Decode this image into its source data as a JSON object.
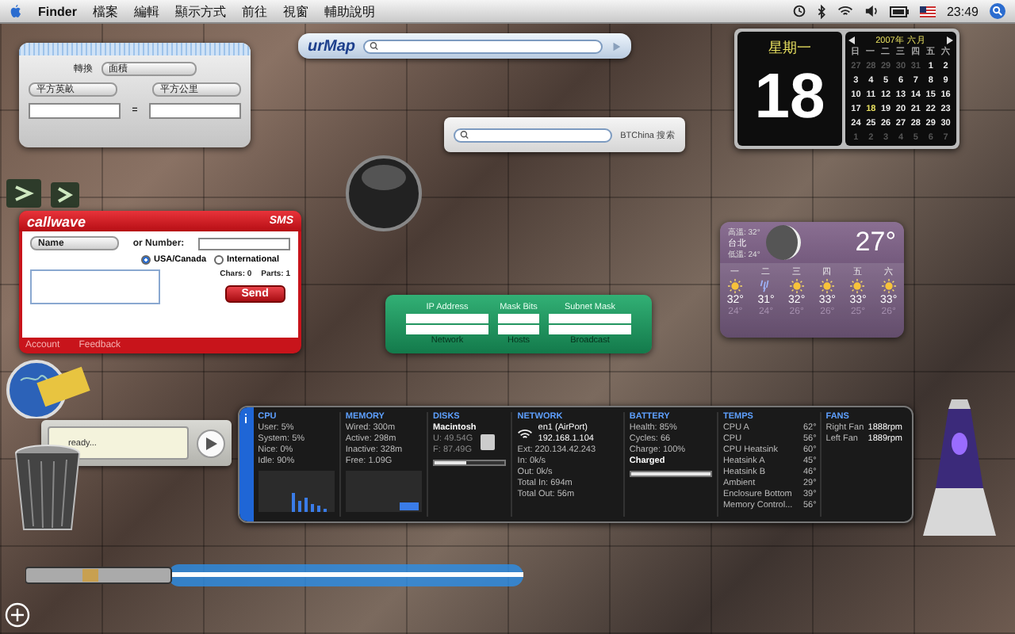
{
  "menu_bar": {
    "app": "Finder",
    "menus": [
      "檔案",
      "編輯",
      "顯示方式",
      "前往",
      "視窗",
      "輔助說明"
    ],
    "clock": "23:49"
  },
  "converter": {
    "type_label": "轉換",
    "type_value": "面積",
    "from_unit": "平方英畝",
    "to_unit": "平方公里",
    "equals": "="
  },
  "urmap": {
    "logo": "urMap"
  },
  "btchina": {
    "label": "BTChina 搜索"
  },
  "calendar": {
    "weekday": "星期一",
    "day": "18",
    "month_title": "2007年 六月",
    "headers": [
      "日",
      "一",
      "二",
      "三",
      "四",
      "五",
      "六"
    ],
    "weeks": [
      [
        {
          "d": "27",
          "muted": true,
          "selected": false
        },
        {
          "d": "28",
          "muted": true,
          "selected": false
        },
        {
          "d": "29",
          "muted": true,
          "selected": false
        },
        {
          "d": "30",
          "muted": true,
          "selected": false
        },
        {
          "d": "31",
          "muted": true,
          "selected": false
        },
        {
          "d": "1",
          "muted": false,
          "selected": false
        },
        {
          "d": "2",
          "muted": false,
          "selected": false
        }
      ],
      [
        {
          "d": "3",
          "muted": false,
          "selected": false
        },
        {
          "d": "4",
          "muted": false,
          "selected": false
        },
        {
          "d": "5",
          "muted": false,
          "selected": false
        },
        {
          "d": "6",
          "muted": false,
          "selected": false
        },
        {
          "d": "7",
          "muted": false,
          "selected": false
        },
        {
          "d": "8",
          "muted": false,
          "selected": false
        },
        {
          "d": "9",
          "muted": false,
          "selected": false
        }
      ],
      [
        {
          "d": "10",
          "muted": false,
          "selected": false
        },
        {
          "d": "11",
          "muted": false,
          "selected": false
        },
        {
          "d": "12",
          "muted": false,
          "selected": false
        },
        {
          "d": "13",
          "muted": false,
          "selected": false
        },
        {
          "d": "14",
          "muted": false,
          "selected": false
        },
        {
          "d": "15",
          "muted": false,
          "selected": false
        },
        {
          "d": "16",
          "muted": false,
          "selected": false
        }
      ],
      [
        {
          "d": "17",
          "muted": false,
          "selected": false
        },
        {
          "d": "18",
          "muted": false,
          "selected": true
        },
        {
          "d": "19",
          "muted": false,
          "selected": false
        },
        {
          "d": "20",
          "muted": false,
          "selected": false
        },
        {
          "d": "21",
          "muted": false,
          "selected": false
        },
        {
          "d": "22",
          "muted": false,
          "selected": false
        },
        {
          "d": "23",
          "muted": false,
          "selected": false
        }
      ],
      [
        {
          "d": "24",
          "muted": false,
          "selected": false
        },
        {
          "d": "25",
          "muted": false,
          "selected": false
        },
        {
          "d": "26",
          "muted": false,
          "selected": false
        },
        {
          "d": "27",
          "muted": false,
          "selected": false
        },
        {
          "d": "28",
          "muted": false,
          "selected": false
        },
        {
          "d": "29",
          "muted": false,
          "selected": false
        },
        {
          "d": "30",
          "muted": false,
          "selected": false
        }
      ],
      [
        {
          "d": "1",
          "muted": true,
          "selected": false
        },
        {
          "d": "2",
          "muted": true,
          "selected": false
        },
        {
          "d": "3",
          "muted": true,
          "selected": false
        },
        {
          "d": "4",
          "muted": true,
          "selected": false
        },
        {
          "d": "5",
          "muted": true,
          "selected": false
        },
        {
          "d": "6",
          "muted": true,
          "selected": false
        },
        {
          "d": "7",
          "muted": true,
          "selected": false
        }
      ]
    ]
  },
  "sms": {
    "brand": "callwave",
    "title": "SMS",
    "name_select": "Name",
    "number_label": "or Number:",
    "regions": [
      {
        "label": "USA/Canada",
        "selected": true
      },
      {
        "label": "International",
        "selected": false
      }
    ],
    "chars": "Chars: 0",
    "parts": "Parts: 1",
    "send": "Send",
    "links": [
      "Account",
      "Feedback"
    ]
  },
  "weather": {
    "high": "高溫: 32°",
    "city": "台北",
    "low": "低溫: 24°",
    "temp": "27°",
    "forecast": [
      {
        "day": "一",
        "kind": "sunny",
        "high": "32°",
        "low": "24°"
      },
      {
        "day": "二",
        "kind": "rain",
        "high": "31°",
        "low": "24°"
      },
      {
        "day": "三",
        "kind": "sunny",
        "high": "32°",
        "low": "26°"
      },
      {
        "day": "四",
        "kind": "sunny",
        "high": "33°",
        "low": "26°"
      },
      {
        "day": "五",
        "kind": "sunny",
        "high": "33°",
        "low": "25°"
      },
      {
        "day": "六",
        "kind": "sunny",
        "high": "33°",
        "low": "26°"
      }
    ]
  },
  "subnet": {
    "top_labels": [
      "IP Address",
      "Mask Bits",
      "Subnet Mask"
    ],
    "bottom_labels": [
      "Network",
      "Hosts",
      "Broadcast"
    ]
  },
  "player": {
    "status": "ready..."
  },
  "stats": {
    "cpu": {
      "title": "CPU",
      "lines": [
        "User: 5%",
        "System: 5%",
        "Nice: 0%",
        "Idle: 90%"
      ]
    },
    "memory": {
      "title": "MEMORY",
      "lines": [
        "Wired: 300m",
        "Active: 298m",
        "Inactive: 328m",
        "Free: 1.09G"
      ]
    },
    "disks": {
      "title": "DISKS",
      "name": "Macintosh",
      "lines": [
        "U: 49.54G",
        "F: 87.49G"
      ],
      "level": 0.45
    },
    "network": {
      "title": "NETWORK",
      "interface": "en1 (AirPort)",
      "ip": "192.168.1.104",
      "lines": [
        "Ext: 220.134.42.243",
        "In: 0k/s",
        "Out: 0k/s",
        "Total In: 694m",
        "Total Out: 56m"
      ]
    },
    "battery": {
      "title": "BATTERY",
      "lines": [
        "Health: 85%",
        "Cycles: 66",
        "Charge: 100%",
        "Charged"
      ],
      "level": 1.0
    },
    "temps": {
      "title": "TEMPS",
      "rows": [
        [
          "CPU A",
          "62°"
        ],
        [
          "CPU",
          "56°"
        ],
        [
          "CPU Heatsink",
          "60°"
        ],
        [
          "Heatsink A",
          "45°"
        ],
        [
          "Heatsink B",
          "46°"
        ],
        [
          "Ambient",
          "29°"
        ],
        [
          "Enclosure Bottom",
          "39°"
        ],
        [
          "Memory Control...",
          "56°"
        ]
      ]
    },
    "fans": {
      "title": "FANS",
      "rows": [
        [
          "Right Fan",
          "1888rpm"
        ],
        [
          "Left Fan",
          "1889rpm"
        ]
      ]
    }
  }
}
